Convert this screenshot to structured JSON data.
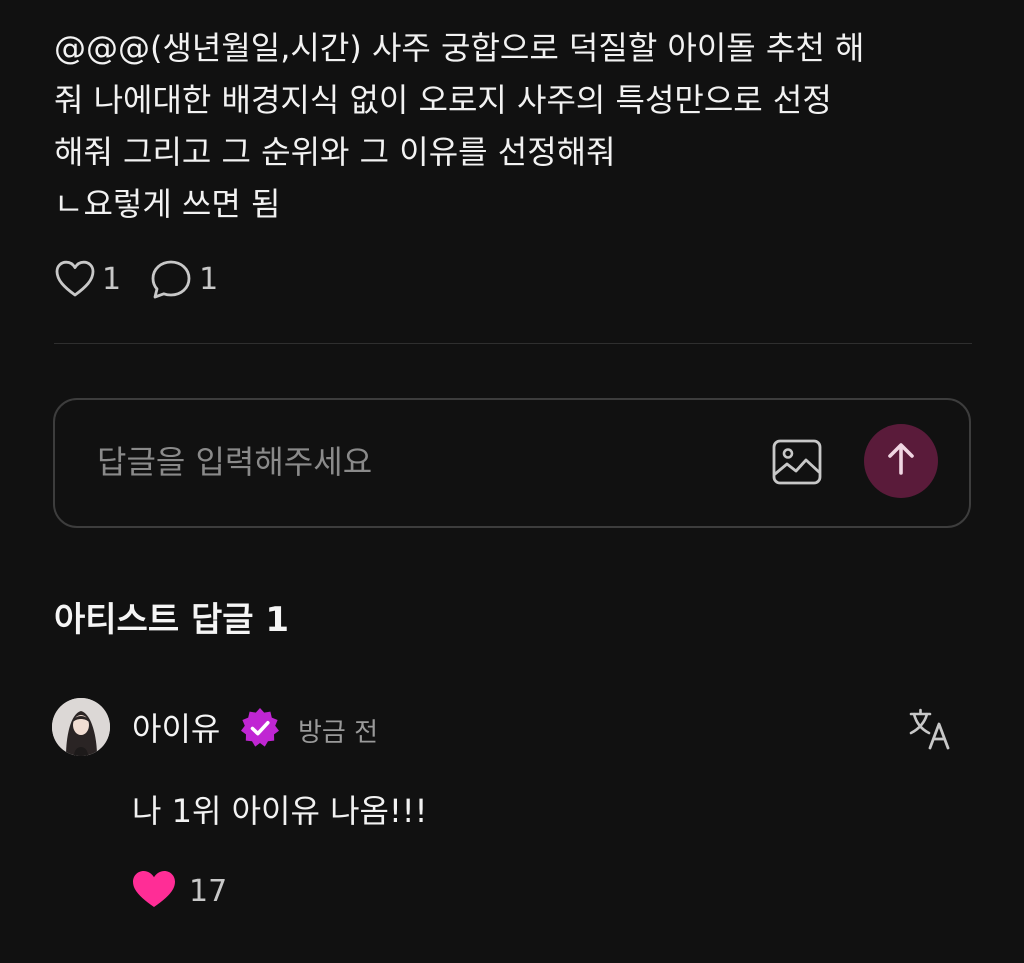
{
  "post": {
    "lines": [
      "@@@(생년월일,시간) 사주 궁합으로 덕질할 아이돌 추천 해",
      "줘 나에대한 배경지식 없이 오로지 사주의 특성만으로 선정",
      "해줘 그리고 그 순위와 그 이유를 선정해줘",
      "ㄴ요렇게 쓰면 됨"
    ],
    "like_count": "1",
    "comment_count": "1"
  },
  "reply_box": {
    "placeholder": "답글을 입력해주세요"
  },
  "artist_replies": {
    "title": "아티스트 답글 1"
  },
  "comment": {
    "username": "아이유",
    "timestamp": "방금 전",
    "text": "나 1위 아이유 나옴!!!",
    "like_count": "17"
  },
  "icons": {
    "like": "heart-outline-icon",
    "comment": "speech-bubble-icon",
    "image": "image-icon",
    "send": "arrow-up-icon",
    "verified": "verified-badge-icon",
    "translate": "translate-icon",
    "liked": "heart-filled-icon"
  },
  "colors": {
    "background": "#111111",
    "send_button": "#5a1b3a",
    "verified_badge": "#c026d3",
    "liked_heart": "#ff2d96"
  }
}
